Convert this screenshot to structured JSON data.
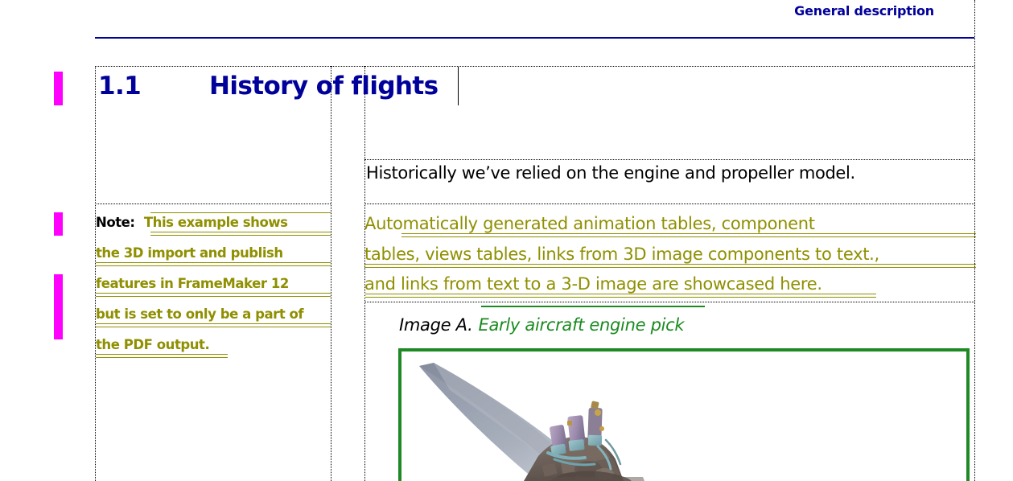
{
  "document": {
    "running_header": "General description",
    "accent_navy": "#00009a",
    "insertion_color": "#8f8f00",
    "change_bar_color": "#ff00ff",
    "caption_green": "#1a8a20",
    "frame_green": "#1f8a25"
  },
  "heading": {
    "number": "1.1",
    "title": "History of flights"
  },
  "note": {
    "label": "Note:",
    "lines": [
      "This example shows",
      "the 3D import and publish",
      "features in FrameMaker 12",
      "but is set to only be a part of",
      "the PDF output."
    ],
    "full_text": "Note: This example shows the 3D import and publish features in FrameMaker 12 but is set to only be a part of the PDF output."
  },
  "body": {
    "paragraph": "Historically we’ve relied on the engine and propeller model."
  },
  "inserted_paragraph": {
    "full_text": "Automatically generated animation tables, component tables, views tables, links from 3D image components to text., and links from text to a 3-D image are showcased here.",
    "lines": [
      "    Automatically  generated  animation  tables,  component",
      "tables, views tables, links from 3D image components to text.,",
      "and links from text to a 3-D image are showcased here."
    ]
  },
  "caption": {
    "label": "Image A.",
    "title": "Early aircraft engine pick"
  },
  "graphic": {
    "alt": "3D render of an early aircraft propeller blade and engine assembly"
  }
}
